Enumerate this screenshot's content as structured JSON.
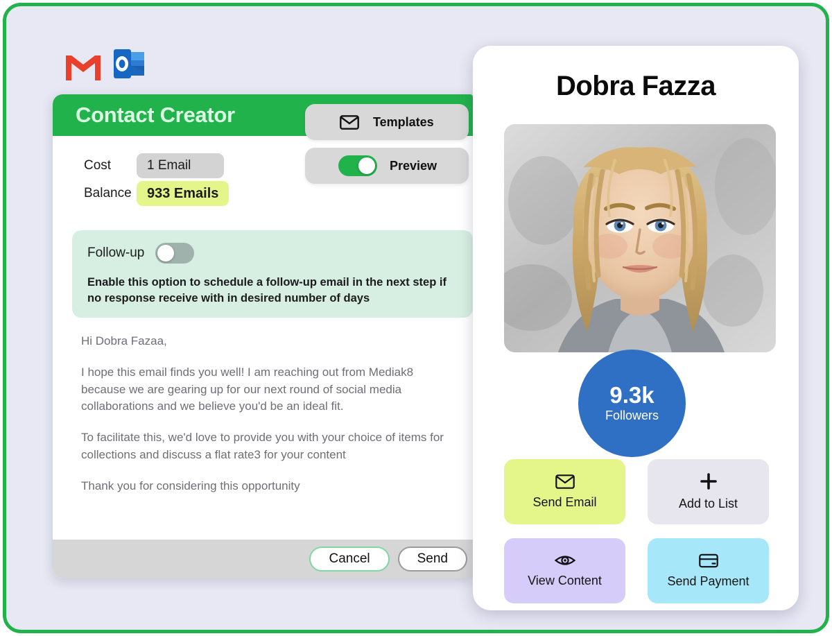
{
  "theme": {
    "frame_border": "#22b24c",
    "page_bg": "#e7e8f3",
    "brand_green": "#22b24c",
    "lime": "#e4f58a",
    "mint": "#d6efe2",
    "badge_blue": "#2f6fc4"
  },
  "providers": [
    {
      "name": "gmail",
      "icon": "gmail-icon"
    },
    {
      "name": "outlook",
      "icon": "outlook-icon"
    }
  ],
  "left_card": {
    "title": "Contact Creator",
    "meter": [
      {
        "label": "Cost",
        "value": "1 Email",
        "style": "grey"
      },
      {
        "label": "Balance",
        "value": "933 Emails",
        "style": "lime"
      }
    ],
    "templates": {
      "label": "Templates",
      "icon": "envelope-icon"
    },
    "preview": {
      "label": "Preview",
      "toggle_state": "on"
    },
    "followup": {
      "title": "Follow-up",
      "toggle_state": "off",
      "description": "Enable this option to schedule a follow-up email in the next step if no response receive with in desired number of days"
    },
    "email_body": [
      "Hi Dobra Fazaa,",
      "I hope this email finds you well! I am reaching out from Mediak8 because we are gearing up for our next round of social media collaborations and we believe you'd be an ideal fit.",
      "To facilitate this, we'd love to provide you with your choice of items for collections and discuss a flat rate3 for your content",
      "Thank you for considering this opportunity"
    ],
    "footer": {
      "cancel_label": "Cancel",
      "send_label": "Send"
    }
  },
  "right_card": {
    "name": "Dobra Fazza",
    "photo_alt": "portrait of blonde woman smiling outdoors",
    "followers": {
      "count": "9.3k",
      "label": "Followers"
    },
    "actions": [
      {
        "label": "Send Email",
        "icon": "envelope-icon",
        "color": "lime"
      },
      {
        "label": "Add to List",
        "icon": "plus-icon",
        "color": "grey"
      },
      {
        "label": "View Content",
        "icon": "eye-icon",
        "color": "violet"
      },
      {
        "label": "Send Payment",
        "icon": "credit-card-icon",
        "color": "cyan"
      }
    ]
  }
}
